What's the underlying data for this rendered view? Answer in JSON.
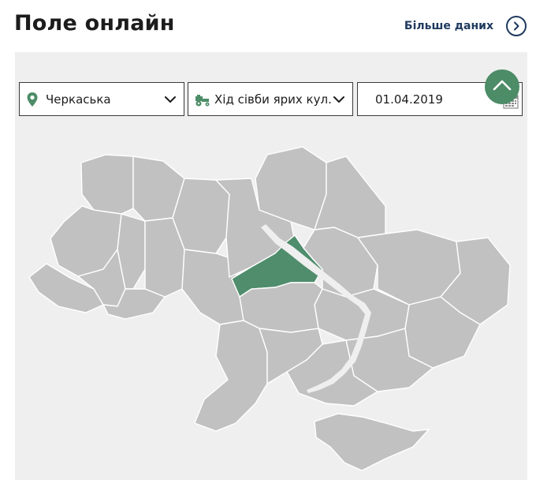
{
  "header": {
    "title": "Поле онлайн",
    "more_link": "Більше даних"
  },
  "filters": {
    "region": "Черкаська",
    "culture": "Хід сівби ярих кул...",
    "date": "01.04.2019"
  },
  "icons": {
    "pin": "location-pin-icon",
    "tractor": "tractor-icon",
    "calendar": "calendar-icon",
    "chevron": "chevron-down-icon",
    "more": "chevron-right-circle-icon",
    "scroll_top": "chevron-up-icon"
  },
  "colors": {
    "accent": "#4f8d6c",
    "region_fill": "#c1c1c1",
    "link": "#1f3a5f",
    "panel_bg": "#efefef"
  },
  "map": {
    "selected_region": "Черкаська"
  }
}
